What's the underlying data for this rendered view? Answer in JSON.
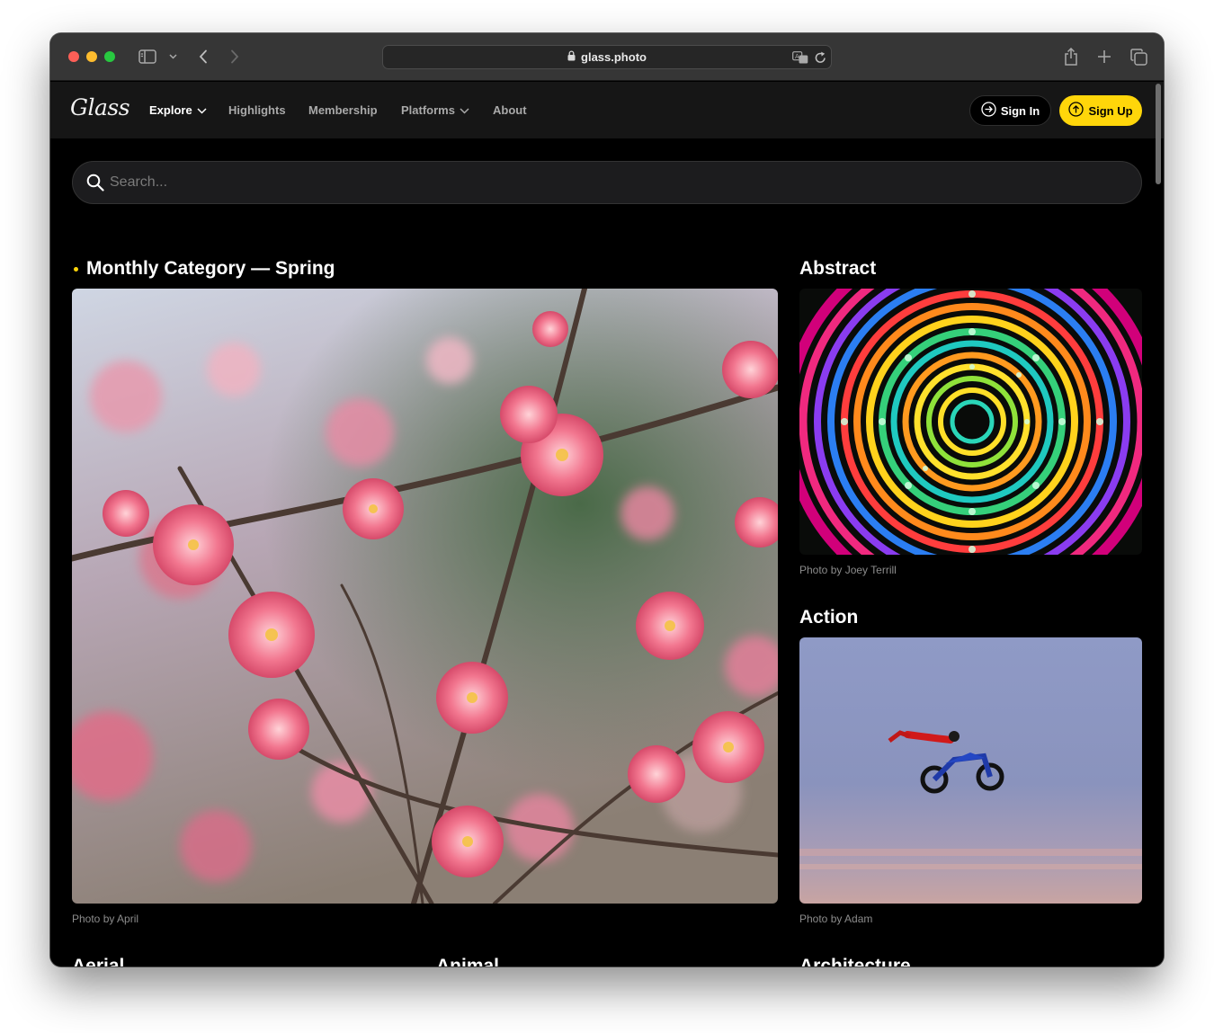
{
  "browser": {
    "url": "glass.photo"
  },
  "nav": {
    "logo": "Glass",
    "items": [
      {
        "label": "Explore"
      },
      {
        "label": "Highlights"
      },
      {
        "label": "Membership"
      },
      {
        "label": "Platforms"
      },
      {
        "label": "About"
      }
    ],
    "sign_in": "Sign In",
    "sign_up": "Sign Up"
  },
  "search": {
    "placeholder": "Search..."
  },
  "featured": {
    "title": "Monthly Category — Spring",
    "credit": "Photo by April"
  },
  "categories": [
    {
      "title": "Abstract",
      "credit": "Photo by Joey Terrill"
    },
    {
      "title": "Action",
      "credit": "Photo by Adam"
    },
    {
      "title": "Aerial"
    },
    {
      "title": "Animal"
    },
    {
      "title": "Architecture"
    }
  ],
  "colors": {
    "accent": "#ffd60a",
    "nav_bg": "#161616",
    "page_bg": "#000000"
  }
}
